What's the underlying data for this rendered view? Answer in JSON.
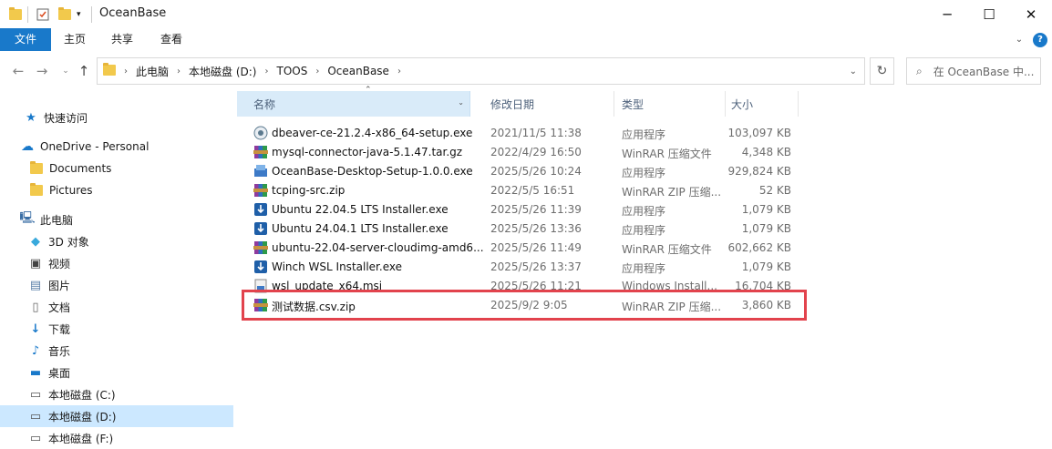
{
  "window": {
    "title": "OceanBase"
  },
  "ribbon": {
    "tabs": [
      "文件",
      "主页",
      "共享",
      "查看"
    ]
  },
  "address": {
    "crumbs": [
      "此电脑",
      "本地磁盘 (D:)",
      "TOOS",
      "OceanBase"
    ],
    "search_placeholder": "在 OceanBase 中..."
  },
  "nav": {
    "items": [
      {
        "label": "快速访问",
        "icon": "star-icon"
      },
      {
        "label": "OneDrive - Personal",
        "icon": "cloud-icon"
      },
      {
        "label": "Documents",
        "icon": "folder-icon"
      },
      {
        "label": "Pictures",
        "icon": "folder-icon"
      },
      {
        "label": "此电脑",
        "icon": "computer-icon"
      },
      {
        "label": "3D 对象",
        "icon": "cube-icon"
      },
      {
        "label": "视频",
        "icon": "video-icon"
      },
      {
        "label": "图片",
        "icon": "picture-icon"
      },
      {
        "label": "文档",
        "icon": "document-icon"
      },
      {
        "label": "下载",
        "icon": "download-icon"
      },
      {
        "label": "音乐",
        "icon": "music-icon"
      },
      {
        "label": "桌面",
        "icon": "desktop-icon"
      },
      {
        "label": "本地磁盘 (C:)",
        "icon": "drive-icon"
      },
      {
        "label": "本地磁盘 (D:)",
        "icon": "drive-icon"
      },
      {
        "label": "本地磁盘 (F:)",
        "icon": "drive-icon"
      }
    ]
  },
  "columns": {
    "name": "名称",
    "date": "修改日期",
    "type": "类型",
    "size": "大小"
  },
  "files": [
    {
      "name": "dbeaver-ce-21.2.4-x86_64-setup.exe",
      "date": "2021/11/5 11:38",
      "type": "应用程序",
      "size": "103,097 KB",
      "icon": "dbeaver-icon"
    },
    {
      "name": "mysql-connector-java-5.1.47.tar.gz",
      "date": "2022/4/29 16:50",
      "type": "WinRAR 压缩文件",
      "size": "4,348 KB",
      "icon": "winrar-icon"
    },
    {
      "name": "OceanBase-Desktop-Setup-1.0.0.exe",
      "date": "2025/5/26 10:24",
      "type": "应用程序",
      "size": "929,824 KB",
      "icon": "installer-icon"
    },
    {
      "name": "tcping-src.zip",
      "date": "2022/5/5 16:51",
      "type": "WinRAR ZIP 压缩...",
      "size": "52 KB",
      "icon": "winrar-icon"
    },
    {
      "name": "Ubuntu 22.04.5 LTS Installer.exe",
      "date": "2025/5/26 11:39",
      "type": "应用程序",
      "size": "1,079 KB",
      "icon": "download-installer-icon"
    },
    {
      "name": "Ubuntu 24.04.1 LTS Installer.exe",
      "date": "2025/5/26 13:36",
      "type": "应用程序",
      "size": "1,079 KB",
      "icon": "download-installer-icon"
    },
    {
      "name": "ubuntu-22.04-server-cloudimg-amd6...",
      "date": "2025/5/26 11:49",
      "type": "WinRAR 压缩文件",
      "size": "602,662 KB",
      "icon": "winrar-icon"
    },
    {
      "name": "Winch WSL Installer.exe",
      "date": "2025/5/26 13:37",
      "type": "应用程序",
      "size": "1,079 KB",
      "icon": "download-installer-icon"
    },
    {
      "name": "wsl_update_x64.msi",
      "date": "2025/5/26 11:21",
      "type": "Windows Install...",
      "size": "16,704 KB",
      "icon": "msi-icon"
    },
    {
      "name": "测试数据.csv.zip",
      "date": "2025/9/2 9:05",
      "type": "WinRAR ZIP 压缩...",
      "size": "3,860 KB",
      "icon": "winrar-icon"
    }
  ],
  "colors": {
    "accent": "#1979ca",
    "selected": "#cce8ff",
    "highlight_border": "#e2434d"
  }
}
